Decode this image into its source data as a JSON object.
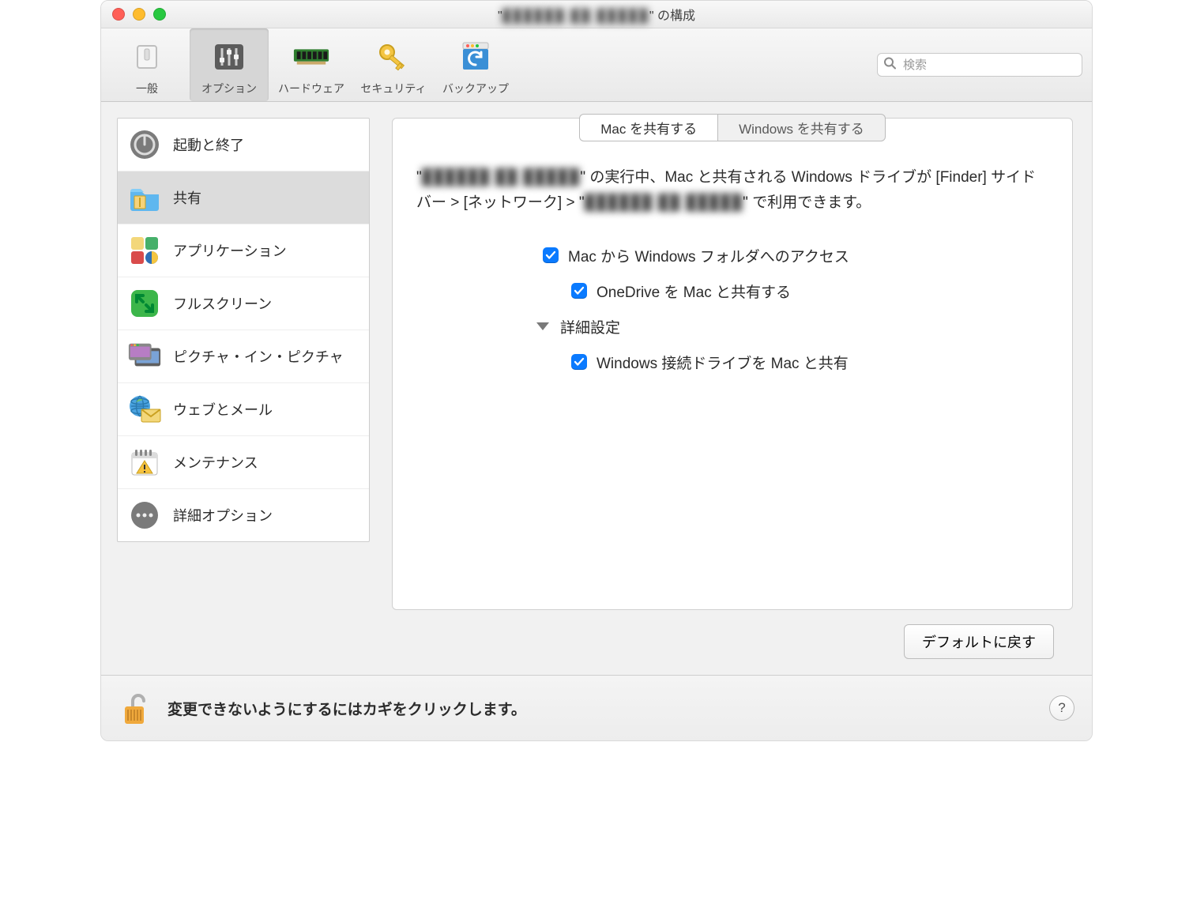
{
  "window": {
    "title_hidden": "██████ ██ █████",
    "title_suffix": "\" の構成"
  },
  "toolbar": {
    "general": "一般",
    "options": "オプション",
    "hardware": "ハードウェア",
    "security": "セキュリティ",
    "backup": "バックアップ",
    "search_placeholder": "検索"
  },
  "sidebar": {
    "startup": "起動と終了",
    "sharing": "共有",
    "applications": "アプリケーション",
    "fullscreen": "フルスクリーン",
    "pip": "ピクチャ・イン・ピクチャ",
    "webmail": "ウェブとメール",
    "maintenance": "メンテナンス",
    "advanced": "詳細オプション"
  },
  "tabs": {
    "share_mac": "Mac を共有する",
    "share_win": "Windows を共有する"
  },
  "description": {
    "part1": "\"",
    "hidden1": "██████ ██ █████",
    "part2": "\" の実行中、Mac と共有される Windows ドライブが [Finder] サイドバー > [ネットワーク] > \"",
    "hidden2": "██████ ██ █████",
    "part3": "\" で利用できます。"
  },
  "opts": {
    "access_win_from_mac": "Mac から Windows フォルダへのアクセス",
    "share_onedrive": "OneDrive を Mac と共有する",
    "advanced_header": "詳細設定",
    "share_drives": "Windows 接続ドライブを Mac と共有"
  },
  "buttons": {
    "defaults": "デフォルトに戻す"
  },
  "footer": {
    "lock_text": "変更できないようにするにはカギをクリックします。",
    "help": "?"
  }
}
